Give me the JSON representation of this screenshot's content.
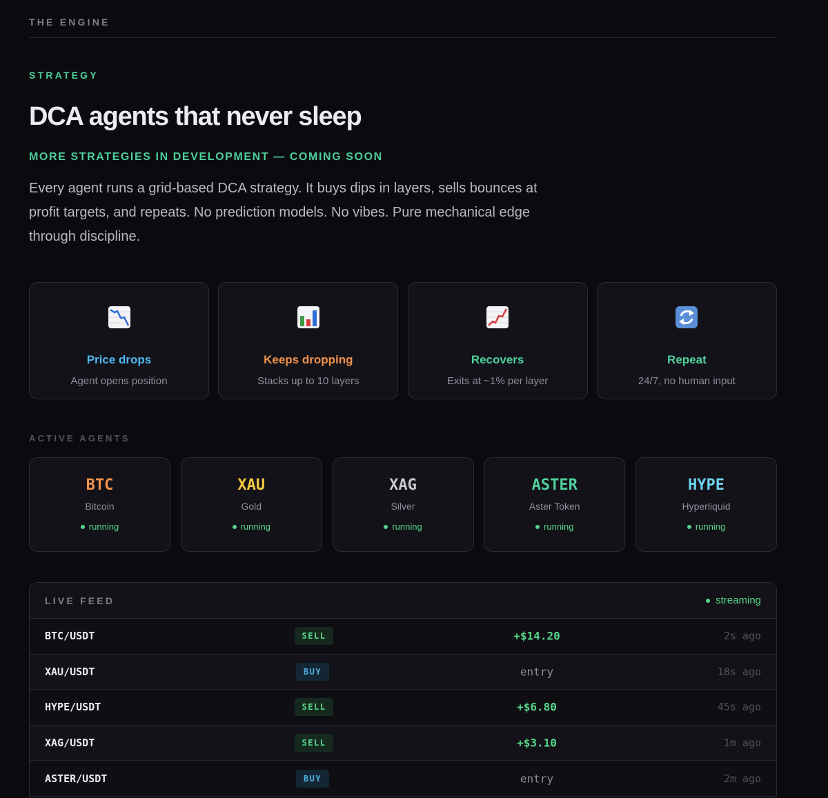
{
  "section": {
    "label": "THE ENGINE"
  },
  "strategy": {
    "kicker": "STRATEGY",
    "headline": "DCA agents that never sleep",
    "subkicker": "MORE STRATEGIES IN DEVELOPMENT — COMING SOON",
    "intro": "Every agent runs a grid-based DCA strategy. It buys dips in layers, sells bounces at profit targets, and repeats. No prediction models. No vibes. Pure mechanical edge through discipline."
  },
  "steps": [
    {
      "icon": "chart-decreasing-icon",
      "title": "Price drops",
      "desc": "Agent opens position",
      "color": "#4fb8f0"
    },
    {
      "icon": "bar-chart-icon",
      "title": "Keeps dropping",
      "desc": "Stacks up to 10 layers",
      "color": "#f0924a"
    },
    {
      "icon": "chart-increasing-icon",
      "title": "Recovers",
      "desc": "Exits at ~1% per layer",
      "color": "#4fcf9c"
    },
    {
      "icon": "repeat-arrows-icon",
      "title": "Repeat",
      "desc": "24/7, no human input",
      "color": "#4fcf9c"
    }
  ],
  "agents": {
    "label": "ACTIVE AGENTS",
    "items": [
      {
        "symbol": "BTC",
        "name": "Bitcoin",
        "status": "running",
        "color": "#f0924a"
      },
      {
        "symbol": "XAU",
        "name": "Gold",
        "status": "running",
        "color": "#f5c842"
      },
      {
        "symbol": "XAG",
        "name": "Silver",
        "status": "running",
        "color": "#c9cbd3"
      },
      {
        "symbol": "ASTER",
        "name": "Aster Token",
        "status": "running",
        "color": "#4fcf9c"
      },
      {
        "symbol": "HYPE",
        "name": "Hyperliquid",
        "status": "running",
        "color": "#6ed3f0"
      }
    ]
  },
  "feed": {
    "title": "LIVE FEED",
    "status": "streaming",
    "rows": [
      {
        "pair": "BTC/USDT",
        "side": "SELL",
        "amount": "+$14.20",
        "time": "2s ago"
      },
      {
        "pair": "XAU/USDT",
        "side": "BUY",
        "amount": "entry",
        "time": "18s ago"
      },
      {
        "pair": "HYPE/USDT",
        "side": "SELL",
        "amount": "+$6.80",
        "time": "45s ago"
      },
      {
        "pair": "XAG/USDT",
        "side": "SELL",
        "amount": "+$3.10",
        "time": "1m ago"
      },
      {
        "pair": "ASTER/USDT",
        "side": "BUY",
        "amount": "entry",
        "time": "2m ago"
      }
    ]
  }
}
